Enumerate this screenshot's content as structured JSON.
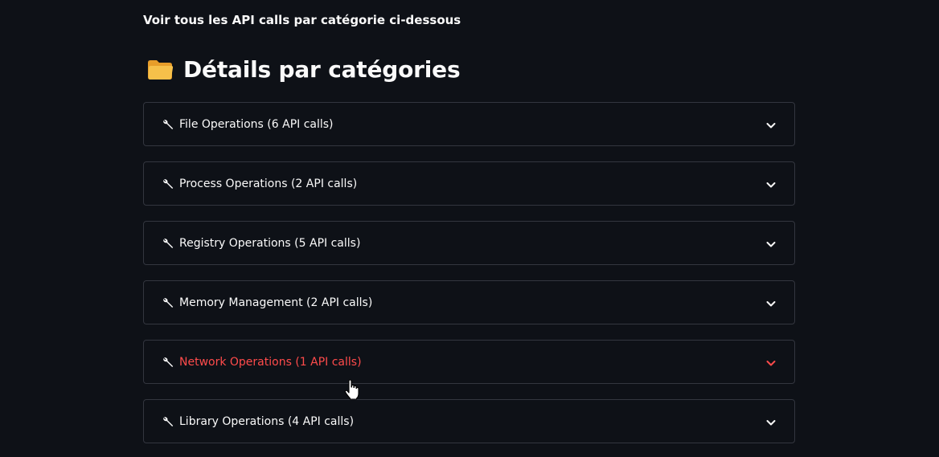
{
  "intro": {
    "text": "Voir tous les API calls par catégorie ci-dessous"
  },
  "section": {
    "icon": "folder-icon",
    "title": "Détails par catégories"
  },
  "expanders": [
    {
      "icon": "wrench-icon",
      "label": "File Operations (6 API calls)",
      "state": "collapsed"
    },
    {
      "icon": "wrench-icon",
      "label": "Process Operations (2 API calls)",
      "state": "collapsed"
    },
    {
      "icon": "wrench-icon",
      "label": "Registry Operations (5 API calls)",
      "state": "collapsed"
    },
    {
      "icon": "wrench-icon",
      "label": "Memory Management (2 API calls)",
      "state": "collapsed"
    },
    {
      "icon": "wrench-icon",
      "label": "Network Operations (1 API calls)",
      "state": "hovered"
    },
    {
      "icon": "wrench-icon",
      "label": "Library Operations (4 API calls)",
      "state": "collapsed"
    }
  ],
  "colors": {
    "background": "#0e1117",
    "text": "#fafafa",
    "border": "#33363f",
    "hover_accent": "#ff4b4b",
    "folder": "#f6b83a"
  }
}
